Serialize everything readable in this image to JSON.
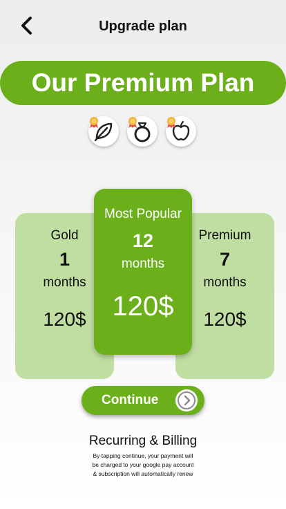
{
  "header": {
    "title": "Upgrade plan",
    "back_icon": "chevron-left-icon"
  },
  "banner": {
    "title": "Our Premium Plan"
  },
  "badges": [
    {
      "icon": "leaf-icon"
    },
    {
      "icon": "ring-icon"
    },
    {
      "icon": "apple-icon"
    }
  ],
  "plans": [
    {
      "name": "Gold",
      "number": "1",
      "unit": "months",
      "price": "120$"
    },
    {
      "name": "Most Popular",
      "number": "12",
      "unit": "months",
      "price": "120$"
    },
    {
      "name": "Premium",
      "number": "7",
      "unit": "months",
      "price": "120$"
    }
  ],
  "continue_button": {
    "label": "Continue",
    "icon": "chevron-right-circle-icon"
  },
  "billing": {
    "title": "Recurring & Billing",
    "lines": [
      "By tapping continue, your payment will",
      "be charged to your google pay account",
      "& subscription will automatically renew"
    ]
  },
  "colors": {
    "accent": "#6bb01a",
    "accent_light": "#c0dea2"
  }
}
